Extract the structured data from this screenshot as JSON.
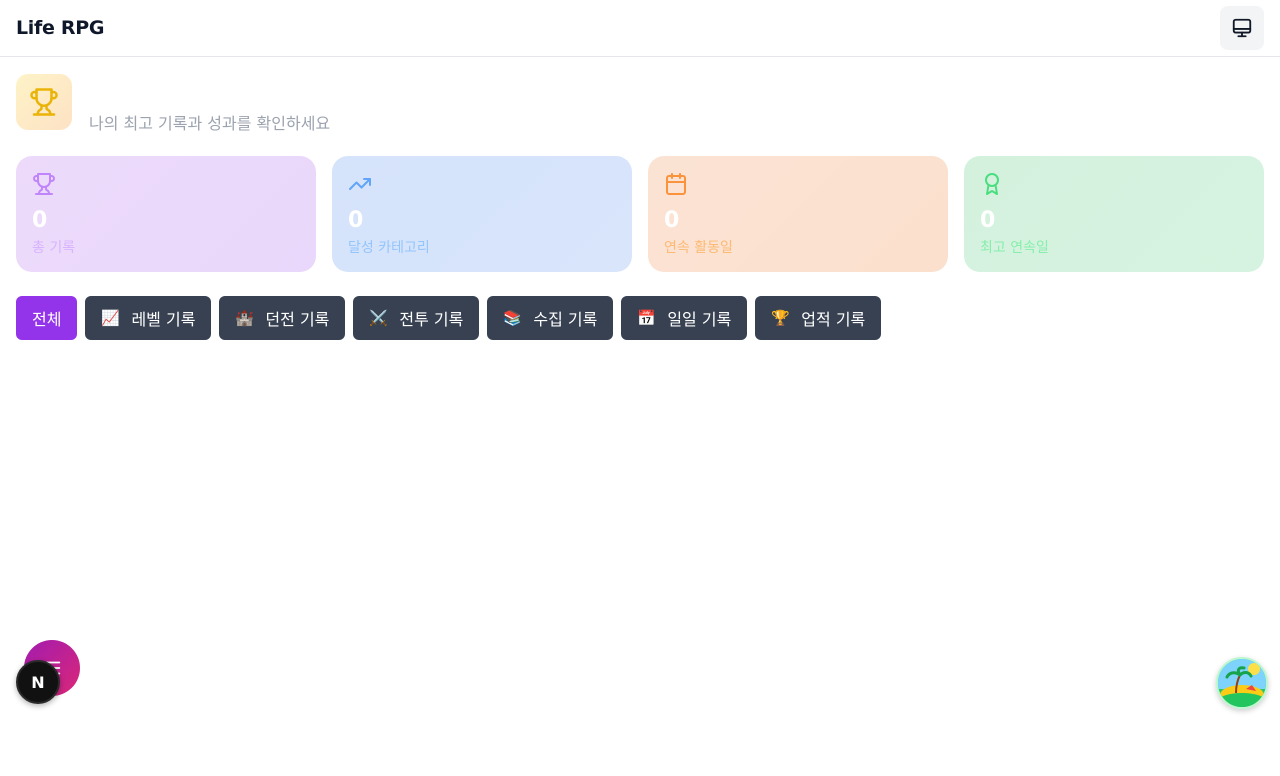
{
  "header": {
    "title": "Life RPG",
    "monitor_icon": "monitor-icon"
  },
  "hero": {
    "icon": "trophy-icon",
    "subtitle": "나의 최고 기록과 성과를 확인하세요"
  },
  "stats": [
    {
      "icon": "trophy-icon",
      "value": "0",
      "label": "총 기록",
      "color": "#c084fc"
    },
    {
      "icon": "trending-up-icon",
      "value": "0",
      "label": "달성 카테고리",
      "color": "#60a5fa"
    },
    {
      "icon": "calendar-icon",
      "value": "0",
      "label": "연속 활동일",
      "color": "#fb923c"
    },
    {
      "icon": "award-icon",
      "value": "0",
      "label": "최고 연속일",
      "color": "#4ade80"
    }
  ],
  "tabs": [
    {
      "label": "전체",
      "active": true
    },
    {
      "emoji": "📈",
      "label": "레벨 기록"
    },
    {
      "emoji": "🏰",
      "label": "던전 기록"
    },
    {
      "emoji": "⚔️",
      "label": "전투 기록"
    },
    {
      "emoji": "📚",
      "label": "수집 기록"
    },
    {
      "emoji": "📅",
      "label": "일일 기록"
    },
    {
      "emoji": "🏆",
      "label": "업적 기록"
    }
  ],
  "fabs": {
    "menu_icon": "menu-icon",
    "dev_badge_letter": "N",
    "island_icon": "island-icon"
  },
  "colors": {
    "accent": "#9333ea",
    "tab_bg": "#374151"
  }
}
